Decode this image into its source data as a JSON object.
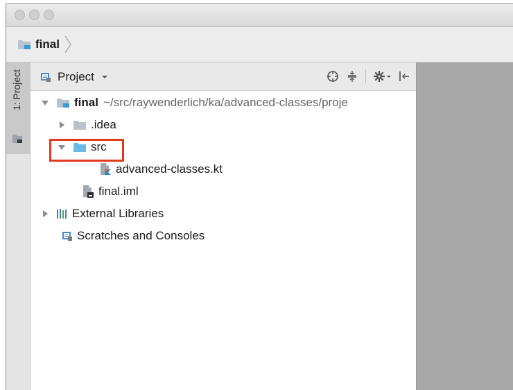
{
  "breadcrumb": {
    "project": "final"
  },
  "toolwindow_strip": {
    "tab_label": "1: Project"
  },
  "panel": {
    "view_label": "Project",
    "tools": [
      "locate-icon",
      "collapse-all-icon",
      "settings-icon",
      "hide-panel-icon"
    ]
  },
  "tree": {
    "root_name": "final",
    "root_path": "~/src/raywenderlich/ka/advanced-classes/proje",
    "idea_folder": ".idea",
    "src_folder": "src",
    "kotlin_file": "advanced-classes.kt",
    "iml_file": "final.iml",
    "external_libraries": "External Libraries",
    "scratches": "Scratches and Consoles"
  },
  "colors": {
    "folder": "#b7c3ce",
    "source_folder": "#6ab9e8",
    "kotlin_accent": "#e35d2b",
    "highlight": "#e33a1c"
  }
}
